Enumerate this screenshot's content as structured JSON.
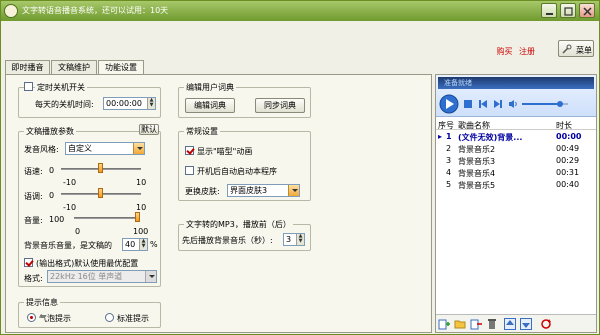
{
  "window": {
    "title": "文字转语音播音系统，还可以试用：10天"
  },
  "header": {
    "buy_label": "购买",
    "register_label": "注册",
    "menu_label": "菜单"
  },
  "tabs": [
    {
      "label": "即时播音"
    },
    {
      "label": "文稿维护"
    },
    {
      "label": "功能设置"
    }
  ],
  "shutdown": {
    "checkbox_label": "定时关机开关",
    "checked": false,
    "time_label": "每天的关机时间:",
    "time_value": "00:00:00"
  },
  "playback": {
    "legend": "文稿播放参数",
    "default_button": "默认",
    "style_label": "发音风格:",
    "style_value": "自定义",
    "rate1_label": "语速:",
    "rate1_zero": "0",
    "rate1_min": "-10",
    "rate1_max": "10",
    "rate1_value": 0,
    "rate2_label": "语调:",
    "rate2_zero": "0",
    "rate2_min": "-10",
    "rate2_max": "10",
    "rate2_value": 0,
    "volume_label": "音量:",
    "volume_current": "100",
    "volume_min": "0",
    "volume_max": "100",
    "volume_value": 100,
    "bg_label": "背景音乐音量，是文稿的",
    "bg_value": "40",
    "bg_unit": "%",
    "output_checkbox": "(输出格式)默认使用最优配置",
    "output_checked": true,
    "format_label": "格式:",
    "format_value": "22kHz 16位 单声道"
  },
  "tips": {
    "legend": "提示信息",
    "bubble_label": "气泡提示",
    "standard_label": "标准提示",
    "selected": "bubble"
  },
  "dict": {
    "legend": "编辑用户词典",
    "edit_button": "编辑词典",
    "sync_button": "同步词典"
  },
  "general": {
    "legend": "常规设置",
    "cat_anim_label": "显示\"喵型\"动画",
    "cat_anim_checked": true,
    "autostart_label": "开机后自动启动本程序",
    "autostart_checked": false,
    "skin_label": "更换皮肤:",
    "skin_value": "界面皮肤3"
  },
  "mp3": {
    "legend": "文字转的MP3，播放前（后）",
    "delay_label": "先后播放背景音乐（秒）:",
    "delay_value": "3"
  },
  "player": {
    "now_playing": "准备就绪"
  },
  "playlist": {
    "headers": [
      "序号",
      "歌曲名称",
      "时长"
    ],
    "rows": [
      {
        "index": "1",
        "name": "(文件无效)背景...",
        "duration": "00:00"
      },
      {
        "index": "2",
        "name": "背景音乐2",
        "duration": "00:49"
      },
      {
        "index": "3",
        "name": "背景音乐3",
        "duration": "00:29"
      },
      {
        "index": "4",
        "name": "背景音乐4",
        "duration": "00:31"
      },
      {
        "index": "5",
        "name": "背景音乐5",
        "duration": "00:40"
      }
    ]
  },
  "colors": {
    "titlebar": "#6f9a2e",
    "accent_red": "#c00000",
    "playlist_active": "#0000a0"
  }
}
